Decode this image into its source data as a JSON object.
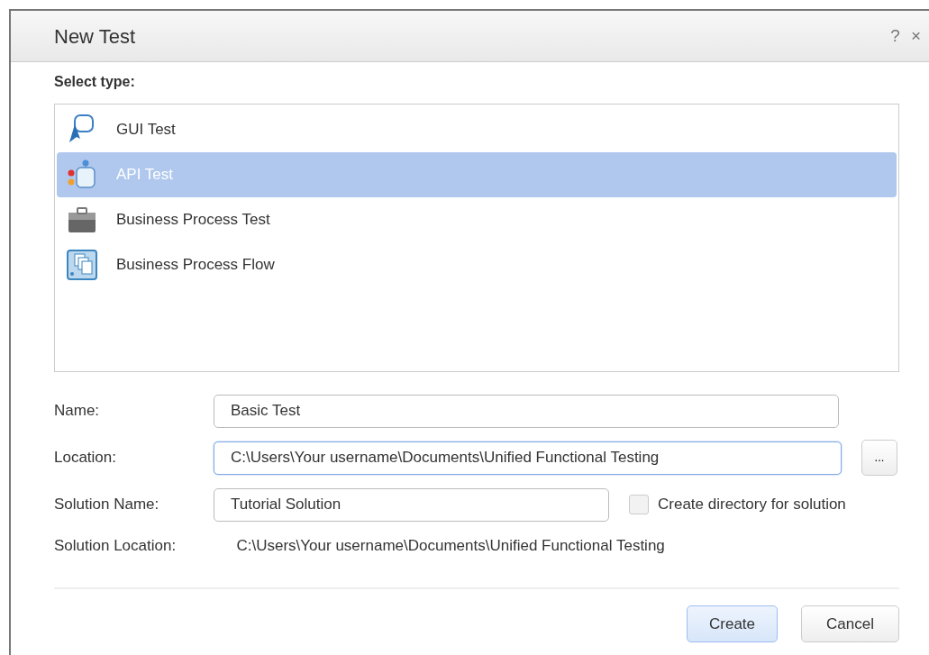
{
  "window": {
    "title": "New Test",
    "help": "?",
    "close": "×"
  },
  "type_label": "Select type:",
  "types": [
    {
      "label": "GUI Test",
      "kind": "gui",
      "selected": false
    },
    {
      "label": "API Test",
      "kind": "api",
      "selected": true
    },
    {
      "label": "Business Process Test",
      "kind": "bpt",
      "selected": false
    },
    {
      "label": "Business Process Flow",
      "kind": "flow",
      "selected": false
    }
  ],
  "fields": [
    {
      "label": "Name:",
      "value": "Basic Test",
      "focused": false,
      "kind": "wide"
    },
    {
      "label": "Location:",
      "value": "C:\\Users\\Your username\\Documents\\Unified Functional Testing",
      "focused": true,
      "kind": "browse",
      "browse": "..."
    },
    {
      "label": "Solution Name:",
      "value": "Tutorial Solution",
      "focused": false,
      "kind": "check",
      "check_label": "Create directory for solution",
      "checked": false
    },
    {
      "label": "Solution Location:",
      "value": "C:\\Users\\Your username\\Documents\\Unified Functional Testing",
      "kind": "text"
    }
  ],
  "buttons": [
    {
      "label": "Create",
      "kind": "default"
    },
    {
      "label": "Cancel",
      "kind": "plain"
    }
  ]
}
